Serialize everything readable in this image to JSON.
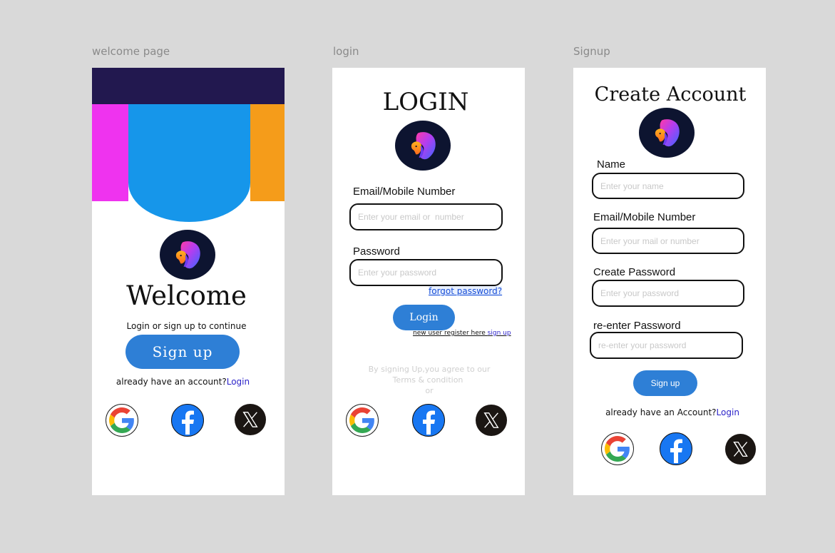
{
  "colors": {
    "background": "#d9d9d9",
    "navy": "#22184f",
    "magenta": "#ef33ef",
    "sky_blue": "#1696ea",
    "orange": "#f59c1a",
    "button_blue": "#2e7fd6",
    "link_blue": "#2b22c9"
  },
  "frames": {
    "welcome": {
      "label": "welcome page",
      "title": "Welcome",
      "subtitle": "Login or sign up to continue",
      "signup_button": "Sign up",
      "account_prompt": "already have an account?",
      "login_link": "Login",
      "social_icons": [
        "google-icon",
        "facebook-icon",
        "x-icon"
      ]
    },
    "login": {
      "label": "login",
      "title": "LOGIN",
      "email_label": "Email/Mobile Number",
      "email_placeholder": "Enter your email or  number",
      "password_label": "Password",
      "password_placeholder": "Enter your password",
      "forgot_link": "forgot password?",
      "login_button": "Login",
      "new_user_text": "new user register here ",
      "signup_link": "sign up",
      "terms_line1": "By signing Up,you agree to our",
      "terms_line2": "Terms & condition",
      "or_text": "or",
      "social_icons": [
        "google-icon",
        "facebook-icon",
        "x-icon"
      ]
    },
    "signup": {
      "label": "Signup",
      "title": "Create Account",
      "name_label": "Name",
      "name_placeholder": "Enter your name",
      "email_label": "Email/Mobile Number",
      "email_placeholder": "Enter your mail or number",
      "password_label": "Create Password",
      "password_placeholder": "Enter your password",
      "reenter_label": "re-enter Password",
      "reenter_placeholder": "re-enter your password",
      "signup_button": "Sign up",
      "account_prompt": "already have an Account?",
      "login_link": "Login",
      "social_icons": [
        "google-icon",
        "facebook-icon",
        "x-icon"
      ]
    }
  }
}
